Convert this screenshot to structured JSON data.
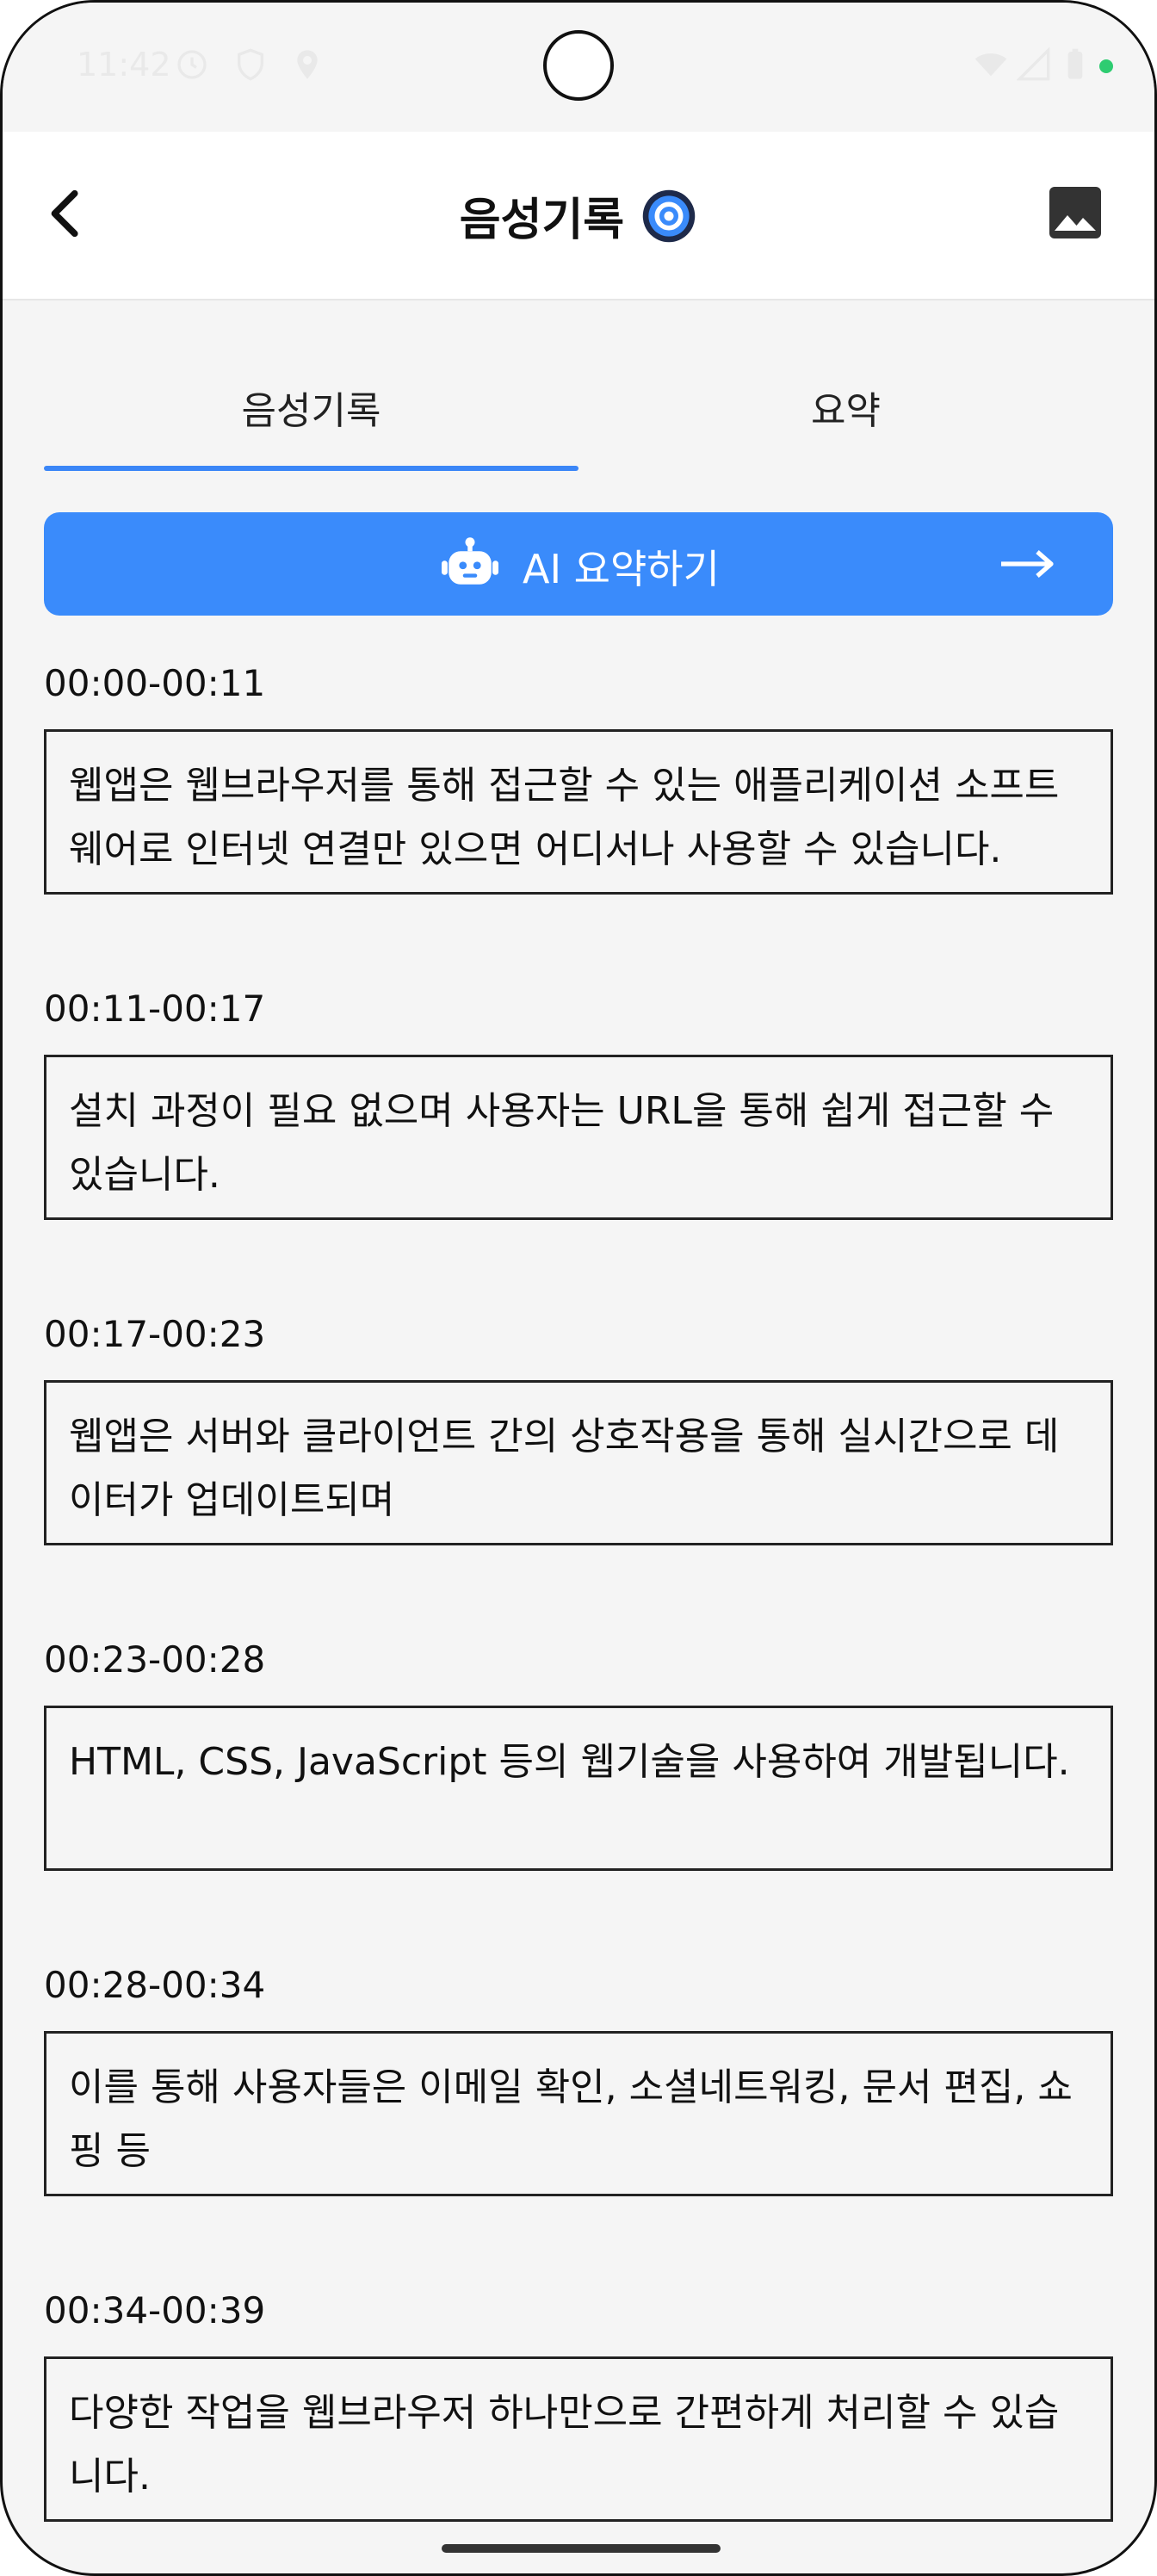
{
  "status_bar": {
    "time": "11:42",
    "icons": [
      "clock-icon",
      "shield-icon",
      "location-icon",
      "wifi-icon",
      "signal-icon",
      "battery-icon"
    ],
    "camera_dot_color": "#2ecc71"
  },
  "app_bar": {
    "title": "음성기록",
    "back_icon": "chevron-left-icon",
    "title_icon": "voice-record-icon",
    "action_icon": "image-icon"
  },
  "tabs": [
    {
      "label": "음성기록",
      "selected": true
    },
    {
      "label": "요약",
      "selected": false
    }
  ],
  "ai_button": {
    "label": "AI 요약하기",
    "icon": "robot-icon",
    "trailing_icon": "arrow-right-icon"
  },
  "entries": [
    {
      "time": "00:00-00:11",
      "text": "웹앱은 웹브라우저를 통해 접근할 수 있는 애플리케이션 소프트웨어로 인터넷 연결만 있으면 어디서나 사용할 수 있습니다."
    },
    {
      "time": "00:11-00:17",
      "text": "설치 과정이 필요 없으며 사용자는 URL을 통해 쉽게 접근할 수 있습니다."
    },
    {
      "time": "00:17-00:23",
      "text": "웹앱은 서버와 클라이언트 간의 상호작용을 통해 실시간으로 데이터가 업데이트되며"
    },
    {
      "time": "00:23-00:28",
      "text": "HTML, CSS, JavaScript 등의 웹기술을 사용하여 개발됩니다."
    },
    {
      "time": "00:28-00:34",
      "text": "이를 통해 사용자들은 이메일 확인, 소셜네트워킹, 문서 편집, 쇼핑 등"
    },
    {
      "time": "00:34-00:39",
      "text": "다양한 작업을 웹브라우저 하나만으로 간편하게 처리할 수 있습니다."
    }
  ],
  "colors": {
    "accent": "#3a8bfb",
    "background": "#f5f5f5"
  }
}
